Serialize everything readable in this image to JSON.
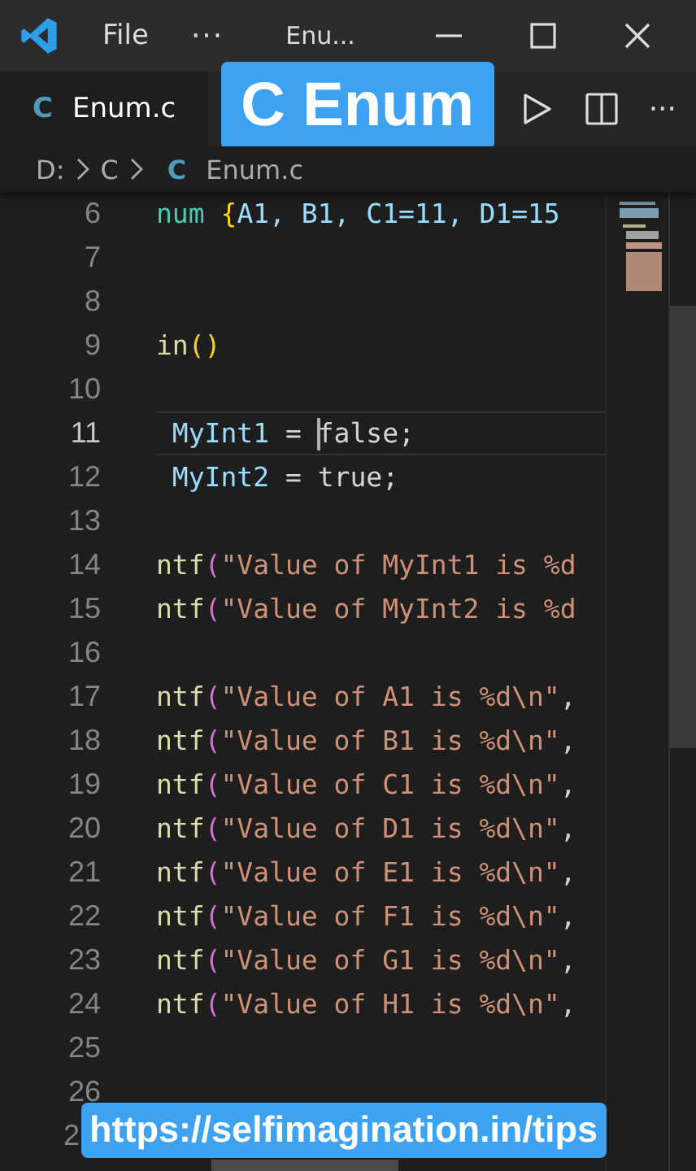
{
  "title_bar": {
    "menu": "File",
    "more": "···",
    "title": "Enu..."
  },
  "tab_bar": {
    "tabs": [
      {
        "icon_text": "C",
        "label": "Enum.c",
        "selected": true
      }
    ],
    "more": "···"
  },
  "breadcrumb": {
    "items": [
      {
        "text": "D:",
        "kind": "folder"
      },
      {
        "text": "C",
        "kind": "folder"
      },
      {
        "icon_text": "C",
        "text": "Enum.c",
        "kind": "file"
      }
    ]
  },
  "editor": {
    "lines": [
      {
        "number": "6",
        "current": false,
        "tokens": [
          {
            "text": "num ",
            "kind": "type"
          },
          {
            "text": "{",
            "kind": "brace"
          },
          {
            "text": "A1, B1, C1=11, D1=15",
            "kind": "variable"
          }
        ]
      },
      {
        "number": "7",
        "current": false
      },
      {
        "number": "8",
        "current": false
      },
      {
        "number": "9",
        "current": false,
        "tokens": [
          {
            "text": "in",
            "kind": "function"
          },
          {
            "text": "()",
            "kind": "brace"
          }
        ]
      },
      {
        "number": "10",
        "current": false
      },
      {
        "number": "11",
        "current": true,
        "tokens": [
          {
            "text": " MyInt1",
            "kind": "variable"
          },
          {
            "text": " = ",
            "kind": "plain"
          },
          {
            "text": "false;",
            "kind": "plain"
          }
        ]
      },
      {
        "number": "12",
        "current": false,
        "tokens": [
          {
            "text": " MyInt2",
            "kind": "variable"
          },
          {
            "text": " = ",
            "kind": "plain"
          },
          {
            "text": "true;",
            "kind": "plain"
          }
        ]
      },
      {
        "number": "13",
        "current": false
      },
      {
        "number": "14",
        "current": false,
        "tokens": [
          {
            "text": "ntf",
            "kind": "function"
          },
          {
            "text": "(",
            "kind": "paren"
          },
          {
            "text": "\"Value of MyInt1 is %d",
            "kind": "string"
          }
        ]
      },
      {
        "number": "15",
        "current": false,
        "tokens": [
          {
            "text": "ntf",
            "kind": "function"
          },
          {
            "text": "(",
            "kind": "paren"
          },
          {
            "text": "\"Value of MyInt2 is %d",
            "kind": "string"
          }
        ]
      },
      {
        "number": "16",
        "current": false
      },
      {
        "number": "17",
        "current": false,
        "tokens": [
          {
            "text": "ntf",
            "kind": "function"
          },
          {
            "text": "(",
            "kind": "paren"
          },
          {
            "text": "\"Value of A1 is %d\\n\"",
            "kind": "string"
          },
          {
            "text": ",",
            "kind": "plain"
          }
        ]
      },
      {
        "number": "18",
        "current": false,
        "tokens": [
          {
            "text": "ntf",
            "kind": "function"
          },
          {
            "text": "(",
            "kind": "paren"
          },
          {
            "text": "\"Value of B1 is %d\\n\"",
            "kind": "string"
          },
          {
            "text": ",",
            "kind": "plain"
          }
        ]
      },
      {
        "number": "19",
        "current": false,
        "tokens": [
          {
            "text": "ntf",
            "kind": "function"
          },
          {
            "text": "(",
            "kind": "paren"
          },
          {
            "text": "\"Value of C1 is %d\\n\"",
            "kind": "string"
          },
          {
            "text": ",",
            "kind": "plain"
          }
        ]
      },
      {
        "number": "20",
        "current": false,
        "tokens": [
          {
            "text": "ntf",
            "kind": "function"
          },
          {
            "text": "(",
            "kind": "paren"
          },
          {
            "text": "\"Value of D1 is %d\\n\"",
            "kind": "string"
          },
          {
            "text": ",",
            "kind": "plain"
          }
        ]
      },
      {
        "number": "21",
        "current": false,
        "tokens": [
          {
            "text": "ntf",
            "kind": "function"
          },
          {
            "text": "(",
            "kind": "paren"
          },
          {
            "text": "\"Value of E1 is %d\\n\"",
            "kind": "string"
          },
          {
            "text": ",",
            "kind": "plain"
          }
        ]
      },
      {
        "number": "22",
        "current": false,
        "tokens": [
          {
            "text": "ntf",
            "kind": "function"
          },
          {
            "text": "(",
            "kind": "paren"
          },
          {
            "text": "\"Value of F1 is %d\\n\"",
            "kind": "string"
          },
          {
            "text": ",",
            "kind": "plain"
          }
        ]
      },
      {
        "number": "23",
        "current": false,
        "tokens": [
          {
            "text": "ntf",
            "kind": "function"
          },
          {
            "text": "(",
            "kind": "paren"
          },
          {
            "text": "\"Value of G1 is %d\\n\"",
            "kind": "string"
          },
          {
            "text": ",",
            "kind": "plain"
          }
        ]
      },
      {
        "number": "24",
        "current": false,
        "tokens": [
          {
            "text": "ntf",
            "kind": "function"
          },
          {
            "text": "(",
            "kind": "paren"
          },
          {
            "text": "\"Value of H1 is %d\\n\"",
            "kind": "string"
          },
          {
            "text": ",",
            "kind": "plain"
          }
        ]
      },
      {
        "number": "25",
        "current": false
      },
      {
        "number": "26",
        "current": false
      },
      {
        "number": "2",
        "current": false,
        "number_clipped": true
      }
    ]
  },
  "overlays": {
    "title_badge": "C Enum",
    "link_banner": "https://selfimagination.in/tips"
  }
}
